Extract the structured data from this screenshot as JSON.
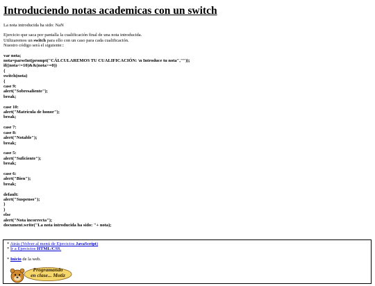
{
  "title": "Introduciendo notas academicas con un switch",
  "result_label": "La nota introducida ha sido: NaN",
  "description": {
    "line1": "Ejercicio que saca por pantalla la cualificación final de una nota introducida.",
    "line2_pre": "Utilizaremos un ",
    "line2_bold": "switch",
    "line2_post": " para ello con un caso para cada cualificación.",
    "line3": "Nuestro código será el siguiente::"
  },
  "code": {
    "l01": "var nota;",
    "l02": "nota=parseInt(prompt(\"CÁLCULAREMOS TU CUALIFICACIÓN: \\n Introduce tu nota\",\"\"));",
    "l03": "if((nota<=10)&&(nota>=0))",
    "l04": "{",
    "l05": "switch(nota)",
    "l06": "{",
    "l07": "case 9:",
    "l08": "alert(\"Sobresaliente\");",
    "l09": "break;",
    "l10": "case 10:",
    "l11": "alert(\"Matrícula de honor\");",
    "l12": "break;",
    "l13": "case 7:",
    "l14": "case 8:",
    "l15": "alert(\"Notable\");",
    "l16": "break;",
    "l17": "case 5:",
    "l18": "alert(\"Suficiente\");",
    "l19": "break;",
    "l20": "case 6:",
    "l21": "alert(\"Bien\");",
    "l22": "break;",
    "l23": "default:",
    "l24": "alert(\"Suspenso\");",
    "l25": "}",
    "l26": "}",
    "l27": "else",
    "l28": "alert(\"Nota incorrecta\");",
    "l29": "document.write(\"La nota introducida ha sido: \"+ nota);"
  },
  "footer": {
    "link1_prefix": "* ",
    "link1_a": "Atrás (Volver al menú de Ejercicios ",
    "link1_b": "JavaScript",
    "link1_c": ")",
    "link2_prefix": "* ",
    "link2_a": "Ir a Ejercicios ",
    "link2_b": "HTML/CSS",
    "link2_c": ".",
    "link3_prefix": "* ",
    "link3_a": "Inicio",
    "link3_b": " de la web.",
    "logo_line1": "Programando",
    "logo_line2": "en clase... Motiz"
  },
  "colors": {
    "link": "#0000cc",
    "text": "#000000",
    "background": "#ffffff"
  }
}
